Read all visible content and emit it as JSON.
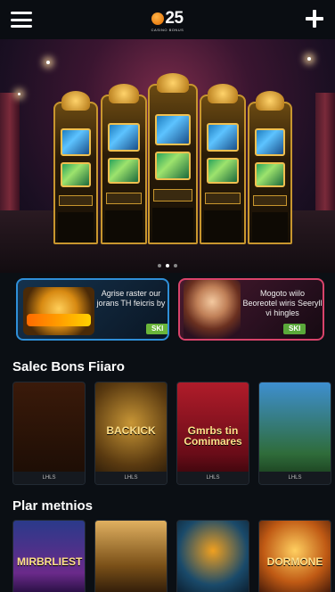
{
  "header": {
    "logo_text": "25",
    "logo_sub": "CASINO BONUS"
  },
  "hero": {
    "slides": 3,
    "active_slide": 1
  },
  "promos": [
    {
      "text": "Agrise raster our jorans TH feicris by",
      "badge": "SKI"
    },
    {
      "text": "Mogoto wiilo Beoreotel wiris Seeryll vi hingles",
      "badge": "SKI"
    }
  ],
  "sections": [
    {
      "title": "Salec Bons Fiiaro",
      "games": [
        {
          "name": "",
          "label": "LHLS"
        },
        {
          "name": "BACKICK",
          "label": "LHLS"
        },
        {
          "name": "Gmrbs tin Comimares",
          "label": "LHLS"
        },
        {
          "name": "",
          "label": "LHLS"
        }
      ]
    },
    {
      "title": "Plar metnios",
      "games": [
        {
          "name": "MIRBRLIEST",
          "label": ""
        },
        {
          "name": "",
          "label": ""
        },
        {
          "name": "",
          "label": ""
        },
        {
          "name": "DORMONE",
          "label": ""
        }
      ]
    }
  ]
}
